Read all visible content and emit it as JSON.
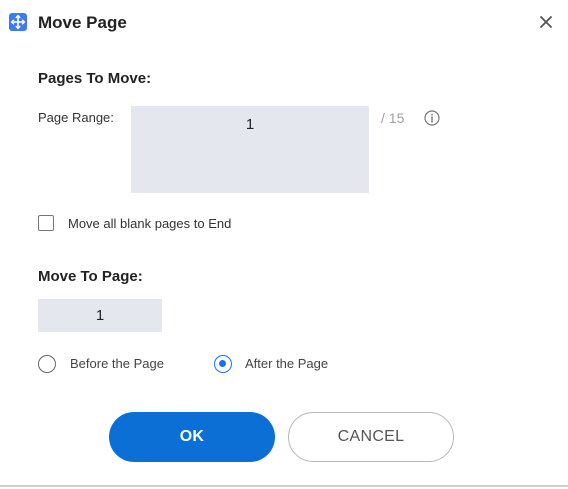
{
  "dialog": {
    "title": "Move Page",
    "icon": "move-page-app-icon",
    "close_icon": "close-icon"
  },
  "pages_to_move": {
    "section_title": "Pages To Move:",
    "range_label": "Page Range:",
    "range_value": "1",
    "total_pages": "/ 15",
    "info_icon": "info-icon"
  },
  "blank_pages": {
    "label": "Move all blank pages to End",
    "checked": false
  },
  "move_to": {
    "section_title": "Move To Page:",
    "page_value": "1",
    "options": [
      {
        "label": "Before the Page",
        "selected": false
      },
      {
        "label": "After the Page",
        "selected": true
      }
    ]
  },
  "buttons": {
    "ok_label": "OK",
    "cancel_label": "CANCEL"
  },
  "colors": {
    "accent": "#0b6fd6",
    "input_bg": "#e4e7ee",
    "app_icon": "#3d7cf0"
  }
}
